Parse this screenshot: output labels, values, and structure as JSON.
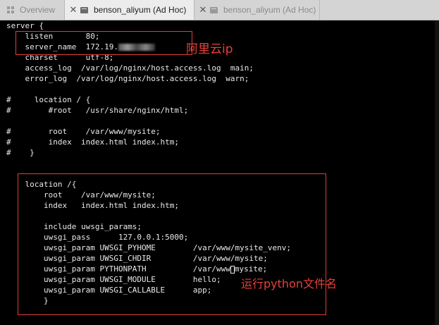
{
  "tabs": [
    {
      "label": "Overview"
    },
    {
      "label": "benson_aliyum (Ad Hoc)"
    },
    {
      "label": "benson_aliyum (Ad Hoc)"
    }
  ],
  "terminal": {
    "lines": [
      "server {",
      "    listen       80;",
      "    server_name  172.19.",
      "    charset      utf-8;",
      "    access_log  /var/log/nginx/host.access.log  main;",
      "    error_log  /var/log/nginx/host.access.log  warn;",
      "",
      "#     location / {",
      "#        #root   /usr/share/nginx/html;",
      "",
      "#        root    /var/www/mysite;",
      "#        index  index.html index.htm;",
      "#    }",
      "",
      "",
      "    location /{",
      "        root    /var/www/mysite;",
      "        index   index.html index.htm;",
      "",
      "        include uwsgi_params;",
      "        uwsgi_pass      127.0.0.1:5000;",
      "        uwsgi_param UWSGI_PYHOME        /var/www/mysite_venv;",
      "        uwsgi_param UWSGI_CHDIR         /var/www/mysite;",
      "        uwsgi_param PYTHONPATH          /var/www",
      "        uwsgi_param UWSGI_MODULE        hello;",
      "        uwsgi_param UWSGI_CALLABLE      app;",
      "        }"
    ],
    "pythonpath_tail": "mysite;"
  },
  "annotations": {
    "ip_label": "阿里云ip",
    "python_label": "运行python文件名",
    "color": "#e8413a"
  }
}
